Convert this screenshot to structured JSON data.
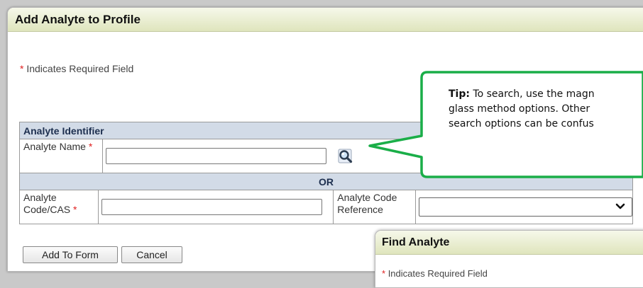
{
  "dialog": {
    "title": "Add Analyte to Profile",
    "required_star": "*",
    "required_note": "Indicates Required Field"
  },
  "form": {
    "section_header": "Analyte Identifier",
    "analyte_name_label": "Analyte Name",
    "analyte_name_value": "",
    "or_label": "OR",
    "analyte_code_label": "Analyte Code/CAS",
    "analyte_code_value": "",
    "code_reference_label": "Analyte Code Reference",
    "code_reference_selected": ""
  },
  "buttons": {
    "add_to_form": "Add To Form",
    "cancel": "Cancel"
  },
  "tip": {
    "prefix": "Tip:",
    "line1": "To search, use the magn",
    "line2": "glass method options. Other",
    "line3": "search options can be confus"
  },
  "find_dialog": {
    "title": "Find Analyte",
    "required_note": "Indicates Required Field"
  },
  "colors": {
    "callout_border": "#1aae48",
    "header_fill": "#d2dbe7",
    "required_star": "#e02020"
  },
  "icons": {
    "search": "magnifier-icon",
    "dropdown": "chevron-down-icon"
  }
}
